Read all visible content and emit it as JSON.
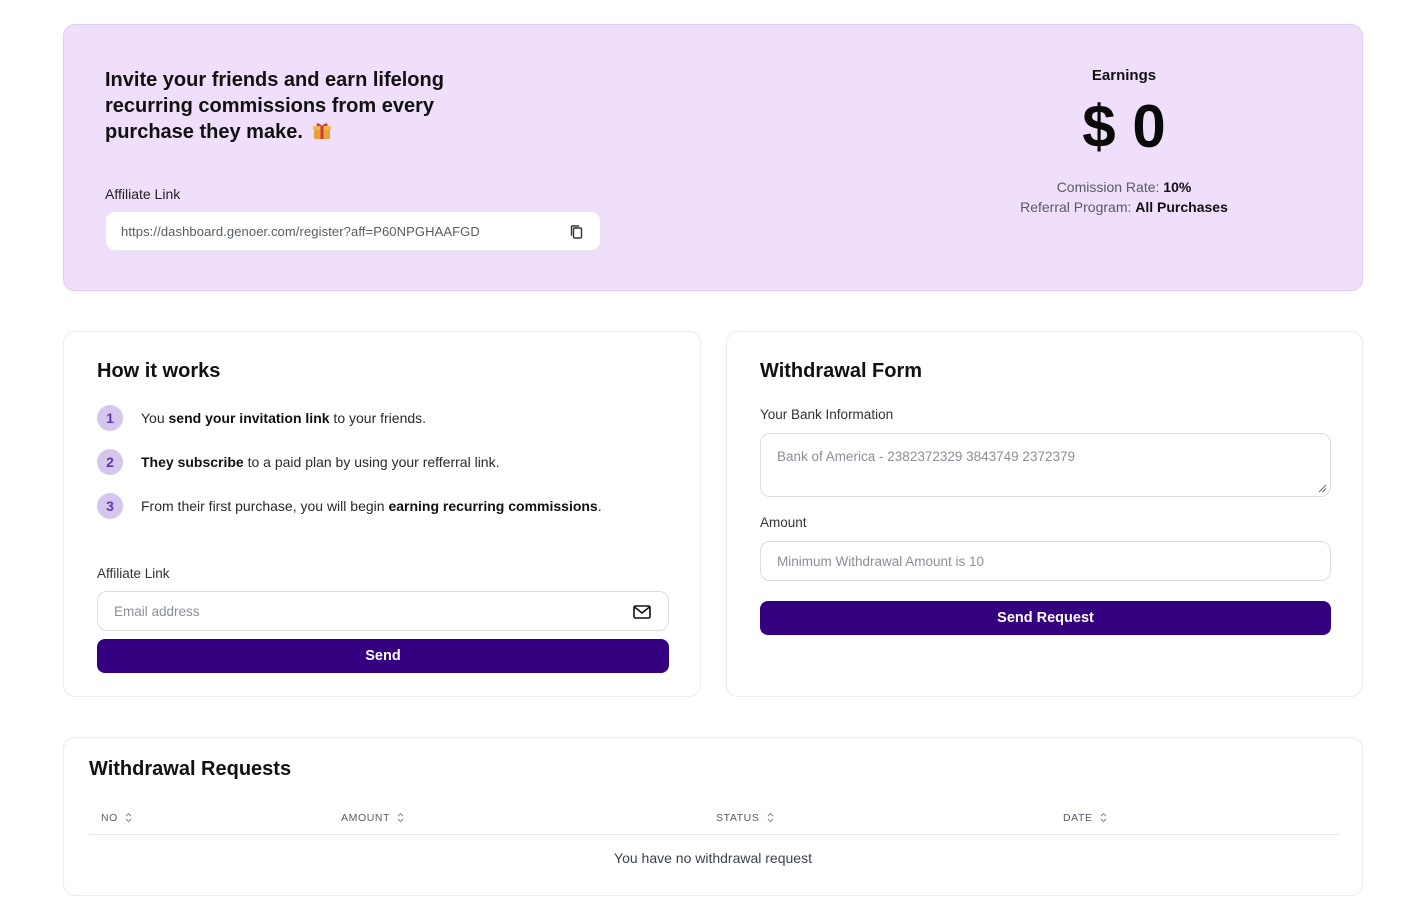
{
  "hero": {
    "title": "Invite your friends and earn lifelong recurring commissions from every purchase they make.",
    "gift_icon": "gift-icon",
    "affiliate_label": "Affiliate Link",
    "affiliate_url": "https://dashboard.genoer.com/register?aff=P60NPGHAAFGD",
    "copy_icon": "copy-icon",
    "earnings_label": "Earnings",
    "earnings_amount": "$ 0",
    "commission_label": "Comission Rate:",
    "commission_value": "10%",
    "program_label": "Referral Program:",
    "program_value": "All Purchases",
    "accent_color": "#efdffa"
  },
  "how_it_works": {
    "title": "How it works",
    "steps": [
      {
        "num": "1",
        "pre": "You ",
        "bold": "send your invitation link",
        "post": " to your friends."
      },
      {
        "num": "2",
        "pre": "",
        "bold": "They subscribe",
        "post": " to a paid plan by using your refferral link."
      },
      {
        "num": "3",
        "pre": "From their first purchase, you will begin ",
        "bold": "earning recurring commissions",
        "post": "."
      }
    ],
    "affiliate_label": "Affiliate Link",
    "email_placeholder": "Email address",
    "mail_icon": "mail-icon",
    "send_label": "Send"
  },
  "withdrawal_form": {
    "title": "Withdrawal Form",
    "bank_label": "Your Bank Information",
    "bank_placeholder": "Bank of America - 2382372329 3843749 2372379",
    "amount_label": "Amount",
    "amount_placeholder": "Minimum Withdrawal Amount is 10",
    "submit_label": "Send Request"
  },
  "withdrawal_requests": {
    "title": "Withdrawal Requests",
    "columns": [
      "NO",
      "AMOUNT",
      "STATUS",
      "DATE"
    ],
    "empty_message": "You have no withdrawal request"
  },
  "colors": {
    "primary_button": "#34007f",
    "step_badge": "#d6c6ee"
  }
}
